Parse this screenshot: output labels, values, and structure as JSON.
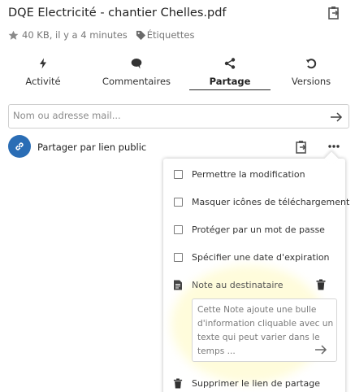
{
  "file": {
    "title": "DQE Electricité - chantier Chelles.pdf",
    "meta": "40 KB, il y a 4 minutes",
    "tags_label": "Étiquettes"
  },
  "tabs": [
    {
      "label": "Activité",
      "icon": "lightning-icon",
      "active": false
    },
    {
      "label": "Commentaires",
      "icon": "comment-icon",
      "active": false
    },
    {
      "label": "Partage",
      "icon": "share-icon",
      "active": true
    },
    {
      "label": "Versions",
      "icon": "history-icon",
      "active": false
    }
  ],
  "search": {
    "placeholder": "Nom ou adresse mail..."
  },
  "public_link": {
    "label": "Partager par lien public"
  },
  "menu": {
    "items": [
      {
        "label": "Permettre la modification",
        "checked": false
      },
      {
        "label": "Masquer icônes de téléchargement",
        "checked": false
      },
      {
        "label": "Protéger par un mot de passe",
        "checked": false
      },
      {
        "label": "Spécifier une date d'expiration",
        "checked": false
      }
    ],
    "note_label": "Note au destinataire",
    "note_text": "Cette Note ajoute une bulle d'information cliquable avec un texte qui peut varier dans le temps ...",
    "delete_label": "Supprimer le lien de partage"
  },
  "colors": {
    "accent": "#2a6db5",
    "text": "#222222",
    "muted": "#767676"
  }
}
